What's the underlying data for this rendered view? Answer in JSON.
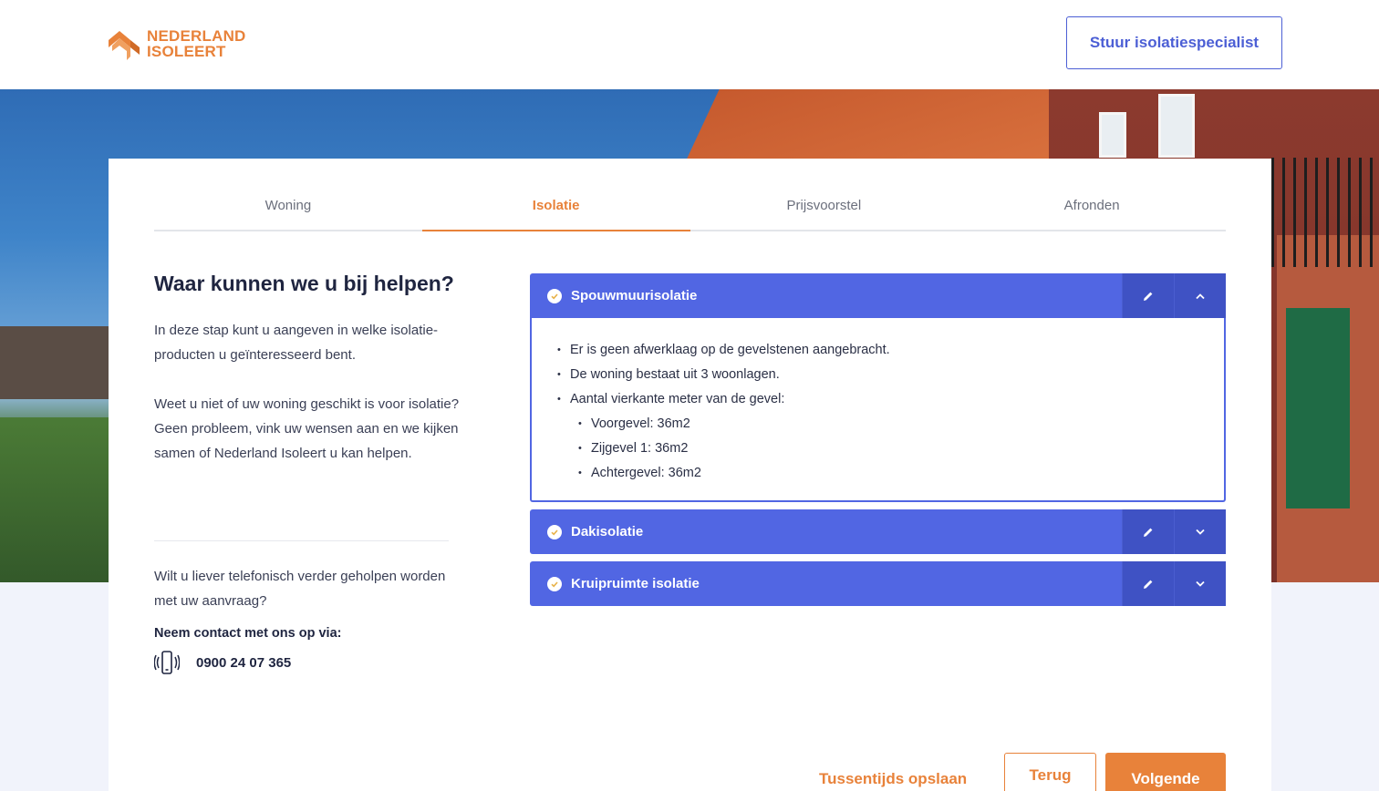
{
  "header": {
    "logo_line1": "NEDERLAND",
    "logo_line2": "ISOLEERT",
    "cta_label": "Stuur isolatiespecialist"
  },
  "tabs": [
    {
      "label": "Woning",
      "active": false
    },
    {
      "label": "Isolatie",
      "active": true
    },
    {
      "label": "Prijsvoorstel",
      "active": false
    },
    {
      "label": "Afronden",
      "active": false
    }
  ],
  "intro": {
    "title": "Waar kunnen we u bij helpen?",
    "text1": "In deze stap kunt u aangeven in welke isolatie-producten u geïnteresseerd bent.",
    "text2": "Weet u niet of uw woning geschikt is voor isolatie? Geen probleem, vink uw wensen aan en we kijken samen of Nederland Isoleert u kan helpen."
  },
  "contact": {
    "question": "Wilt u liever telefonisch verder geholpen worden met uw aanvraag?",
    "label": "Neem contact met ons op via:",
    "phone": "0900 24 07 365"
  },
  "accordion": [
    {
      "title": "Spouwmuurisolatie",
      "expanded": true,
      "items": [
        "Er is geen afwerklaag op de gevelstenen aangebracht.",
        "De woning bestaat uit 3 woonlagen.",
        "Aantal vierkante meter van de gevel:"
      ],
      "subitems": [
        "Voorgevel: 36m2",
        "Zijgevel 1: 36m2",
        "Achtergevel: 36m2"
      ]
    },
    {
      "title": "Dakisolatie",
      "expanded": false
    },
    {
      "title": "Kruipruimte isolatie",
      "expanded": false
    }
  ],
  "actions": {
    "save": "Tussentijds opslaan",
    "back": "Terug",
    "next": "Volgende"
  },
  "colors": {
    "brand_orange": "#e8823a",
    "primary_blue": "#5166e3",
    "primary_blue_dark": "#3f52c4"
  },
  "icons": {
    "check": "check-circle-icon",
    "edit": "pencil-icon",
    "expand": "chevron-down-icon",
    "collapse": "chevron-up-icon",
    "phone": "phone-vibrate-icon"
  }
}
